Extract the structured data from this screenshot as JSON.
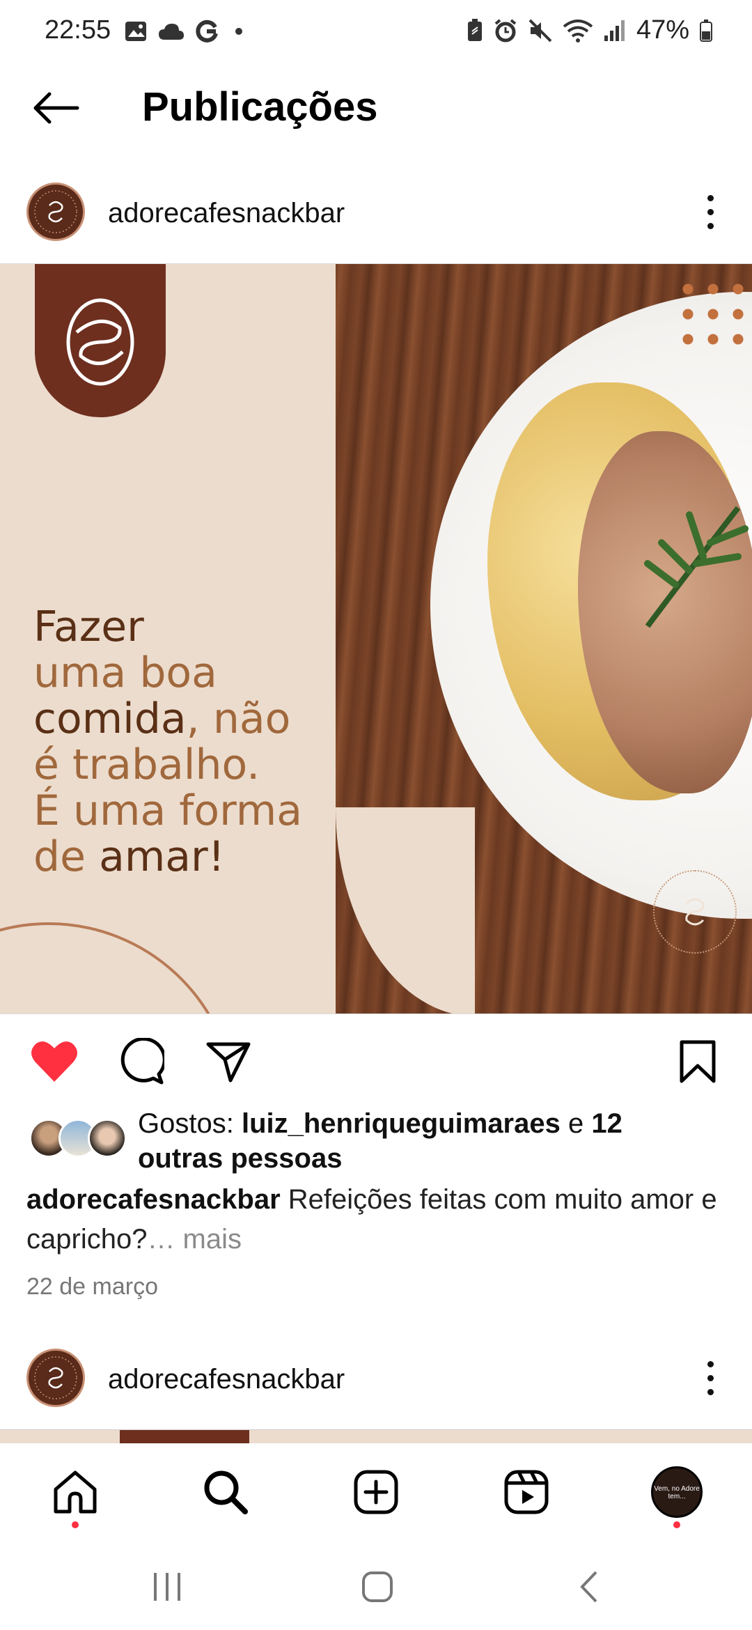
{
  "status_bar": {
    "time": "22:55",
    "battery": "47%",
    "left_icons": [
      "gallery-icon",
      "cloud-icon",
      "google-icon",
      "dot-icon"
    ],
    "right_icons": [
      "battery-saver-icon",
      "alarm-icon",
      "mute-icon",
      "wifi-icon",
      "signal-icon",
      "battery-icon"
    ]
  },
  "header": {
    "title": "Publicações"
  },
  "post": {
    "username": "adorecafesnackbar",
    "image": {
      "headline_lines": [
        {
          "text": "Fazer",
          "tone": "dark"
        },
        {
          "text": "uma boa",
          "tone": "light"
        },
        {
          "parts": [
            {
              "text": "comida",
              "tone": "dark"
            },
            {
              "text": ", não",
              "tone": "light"
            }
          ]
        },
        {
          "text": "é trabalho.",
          "tone": "light"
        },
        {
          "text": "É uma forma",
          "tone": "light"
        },
        {
          "parts": [
            {
              "text": "de ",
              "tone": "light"
            },
            {
              "text": "amar!",
              "tone": "dark"
            }
          ]
        }
      ],
      "watermark_text": "adore cafe snack bar"
    },
    "likes": {
      "prefix": "Gostos: ",
      "user": "luiz_henriqueguimaraes",
      "connector": " e ",
      "others": "12 outras pessoas"
    },
    "caption": {
      "username": "adorecafesnackbar",
      "text": " Refeições feitas com muito amor e capricho?",
      "more": "… mais"
    },
    "date": "22 de março"
  },
  "next_post": {
    "username": "adorecafesnackbar"
  },
  "bottom_nav": {
    "items": [
      "home-icon",
      "search-icon",
      "create-icon",
      "reels-icon",
      "profile-avatar"
    ],
    "profile_thumb_text": "Vem, no Adore tem..."
  },
  "colors": {
    "like_red": "#ff3040",
    "brand_brown": "#6e2f1f",
    "beige": "#ecdccd"
  }
}
